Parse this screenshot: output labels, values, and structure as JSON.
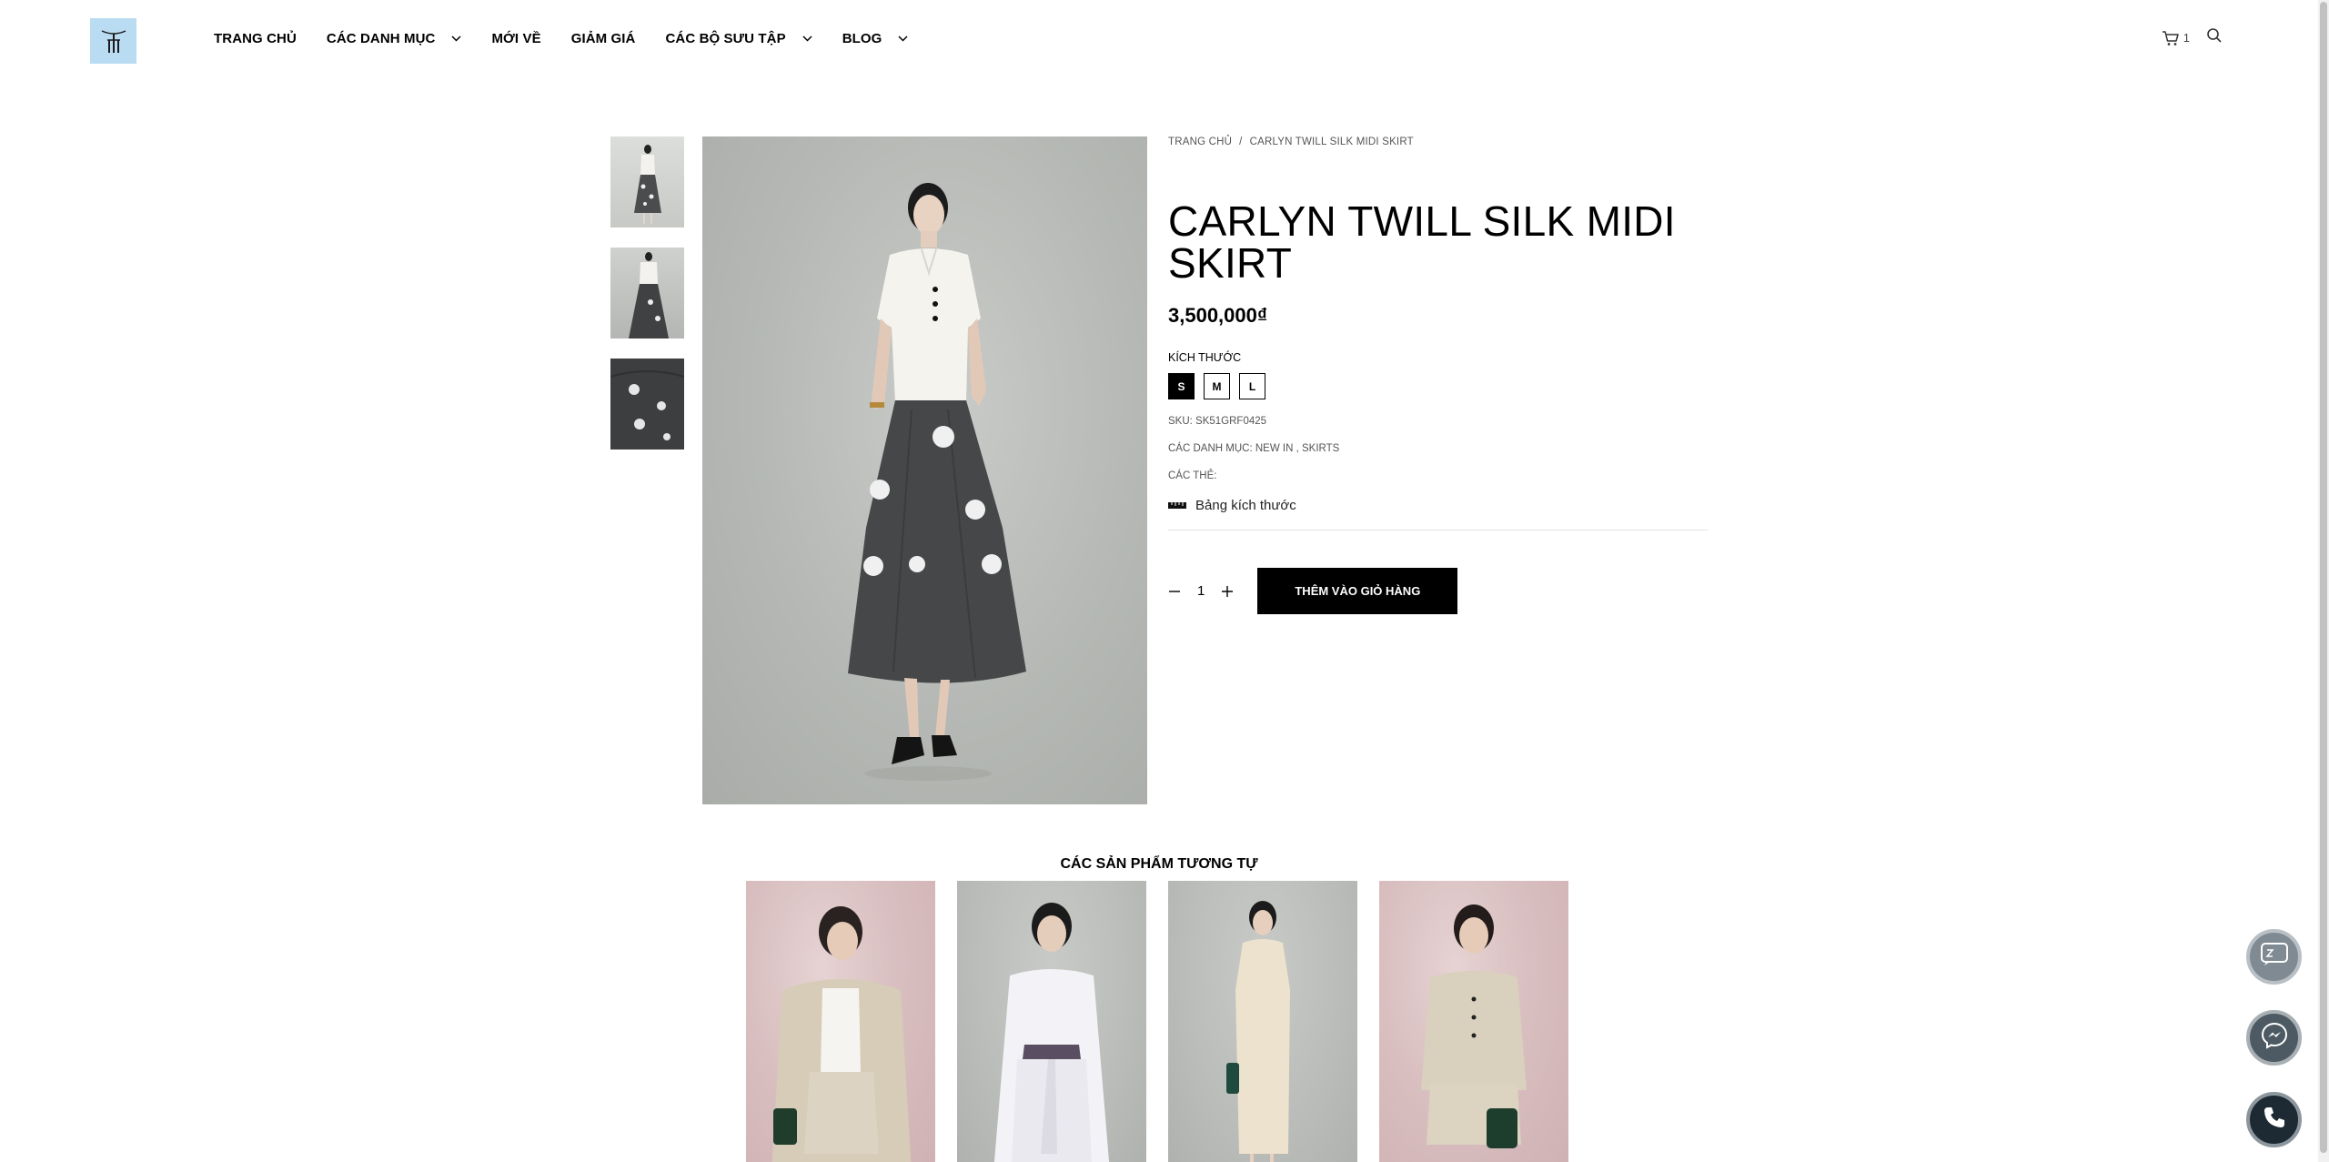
{
  "header": {
    "logo_alt": "brand-logo",
    "nav": [
      {
        "label": "TRANG CHỦ",
        "dropdown": false
      },
      {
        "label": "CÁC DANH MỤC",
        "dropdown": true
      },
      {
        "label": "MỚI VỀ",
        "dropdown": false
      },
      {
        "label": "GIẢM GIÁ",
        "dropdown": false
      },
      {
        "label": "CÁC BỘ SƯU TẬP",
        "dropdown": true
      },
      {
        "label": "BLOG",
        "dropdown": true
      }
    ],
    "cart_count": "1"
  },
  "breadcrumb": {
    "home": "TRANG CHỦ",
    "separator": "/",
    "current": "CARLYN TWILL SILK MIDI SKIRT"
  },
  "product": {
    "title": "CARLYN TWILL SILK MIDI SKIRT",
    "price": "3,500,000₫",
    "size_label": "KÍCH THƯỚC",
    "sizes": [
      "S",
      "M",
      "L"
    ],
    "selected_size": "S",
    "sku_label": "SKU:",
    "sku": "SK51GRF0425",
    "categories_label": "CÁC DANH MỤC:",
    "category_1": "NEW IN",
    "category_sep": ",",
    "category_2": "SKIRTS",
    "tags_label": "CÁC THẺ:",
    "size_guide": "Bảng kích thước",
    "quantity": "1",
    "add_to_cart": "THÊM VÀO GIỎ HÀNG"
  },
  "related": {
    "title": "CÁC SẢN PHẨM TƯƠNG TỰ"
  },
  "colors": {
    "accent": "#000000",
    "logo_bg": "#b9dcf3"
  }
}
